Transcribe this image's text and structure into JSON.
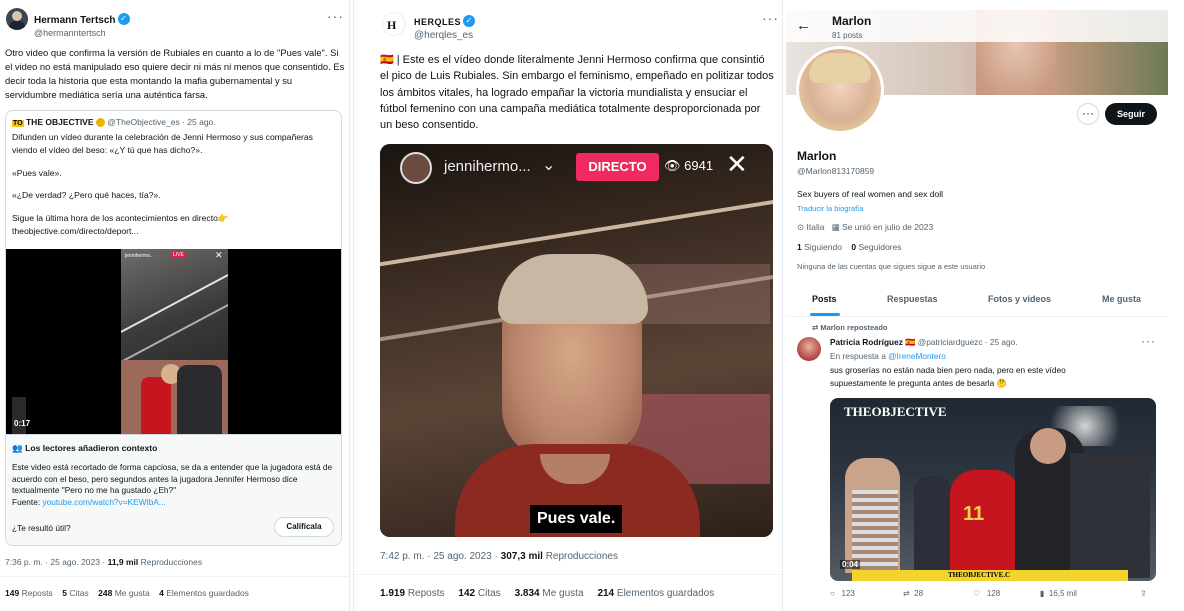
{
  "panel1": {
    "author": {
      "name": "Hermann Tertsch",
      "handle": "@hermanntertsch"
    },
    "tweet_text": "Otro video que confirma la versión de Rubiales en cuanto a lo de \"Pues vale\". Si el video no está manipulado eso quiere decir ni más ni menos que consentido. Es decir toda la historia que esta montando la mafia gubernamental y su servidumbre mediática sería una auténtica farsa.",
    "quote": {
      "badge": "TO",
      "name": "THE OBJECTIVE",
      "handle": "@TheObjective_es",
      "date": "· 25 ago.",
      "text1": "Difunden un vídeo durante la celebración de Jenni Hermoso y sus compañeras viendo el vídeo del beso: «¿Y tú que has dicho?».",
      "text2": "«Pues vale».",
      "text3": "«¿De verdad? ¿Pero qué haces, tía?».",
      "text4": "Sigue la última hora de los acontecimientos en directo👉",
      "text5": "theobjective.com/directo/deport...",
      "video_time": "0:17"
    },
    "context": {
      "title": "Los lectores añadieron contexto",
      "body": "Este video está recortado de forma capciosa, se da a entender que la jugadora está de acuerdo con el beso, pero segundos antes la jugadora Jennifer Hermoso dice textualmente \"Pero no me ha gustado ¿Eh?\"",
      "source_label": "Fuente:",
      "source_link": "youtube.com/watch?v=KEWIbA...",
      "question": "¿Te resultó útil?",
      "rate_button": "Califícala"
    },
    "meta": {
      "time": "7:36 p. m. · 25 ago. 2023 ·",
      "views": "11,9 mil",
      "views_label": "Reproducciones"
    },
    "stats": [
      {
        "value": "149",
        "label": "Reposts"
      },
      {
        "value": "5",
        "label": "Citas"
      },
      {
        "value": "248",
        "label": "Me gusta"
      },
      {
        "value": "4",
        "label": "Elementos guardados"
      }
    ]
  },
  "panel2": {
    "author": {
      "name": "HERQLES",
      "handle": "@herqles_es"
    },
    "tweet_text": "🇪🇸 | Este es el vídeo donde literalmente Jenni Hermoso confirma que consintió el pico de Luis Rubiales. Sin embargo el feminismo, empeñado en politizar todos los ámbitos vitales, ha logrado empañar la victoria mundialista y ensuciar el fútbol femenino con una campaña mediática totalmente desproporcionada por un beso consentido.",
    "video": {
      "live_user": "jennihermo...",
      "live_label": "DIRECTO",
      "viewers": "6941",
      "caption": "Pues vale."
    },
    "meta": {
      "time": "7:42 p. m. · 25 ago. 2023 ·",
      "views": "307,3 mil",
      "views_label": "Reproducciones"
    },
    "stats": [
      {
        "value": "1.919",
        "label": "Reposts"
      },
      {
        "value": "142",
        "label": "Citas"
      },
      {
        "value": "3.834",
        "label": "Me gusta"
      },
      {
        "value": "214",
        "label": "Elementos guardados"
      }
    ]
  },
  "panel3": {
    "header": {
      "name": "Marlon",
      "posts": "81 posts"
    },
    "follow_button": "Seguir",
    "profile": {
      "name": "Marlon",
      "handle": "@Marlon813170859",
      "bio": "Sex buyers of real women and sex doll",
      "translate": "Traducir la biografía",
      "location": "Italia",
      "joined": "Se unió en julio de 2023",
      "following_count": "1",
      "following_label": "Siguiendo",
      "followers_count": "0",
      "followers_label": "Seguidores",
      "known": "Ninguna de las cuentas que sigues sigue a este usuario"
    },
    "tabs": [
      "Posts",
      "Respuestas",
      "Fotos y videos",
      "Me gusta"
    ],
    "post": {
      "repost_label": "Marlon reposteado",
      "author": "Patricia Rodríguez 🇪🇸",
      "handle": "@patriciardguezc",
      "date": "· 25 ago.",
      "reply_prefix": "En respuesta a",
      "reply_to": "@IreneMontero",
      "text": "sus groserías no están nada bien pero nada, pero en este vídeo supuestamente le pregunta antes de besarla 🤔",
      "media_brand": "THEOBJECTIVE",
      "media_footer": "THEOBJECTIVE.C",
      "video_time": "0:04",
      "jersey_number": "11",
      "actions": [
        "123",
        "28",
        "128",
        "16,5 mil"
      ]
    }
  }
}
